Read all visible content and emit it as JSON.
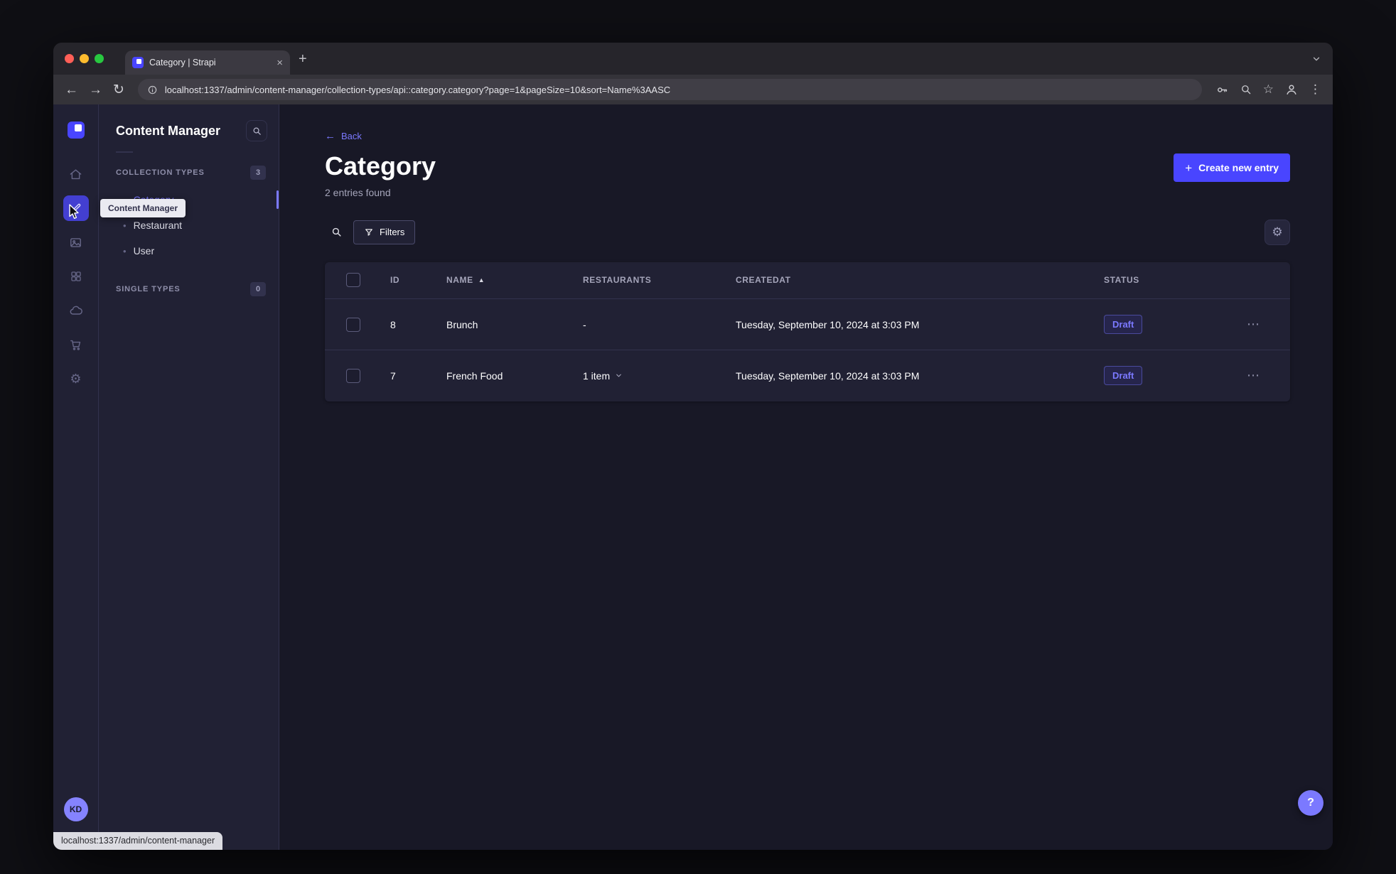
{
  "browser": {
    "tab_title": "Category | Strapi",
    "url": "localhost:1337/admin/content-manager/collection-types/api::category.category?page=1&pageSize=10&sort=Name%3AASC",
    "status_bubble": "localhost:1337/admin/content-manager"
  },
  "icons": {
    "back_arrow": "←",
    "forward_arrow": "→",
    "reload": "↻",
    "star": "☆",
    "menu_dots": "⋮",
    "close": "×",
    "new_tab": "+",
    "plus": "+",
    "bullet": "•",
    "row_actions": "⋯",
    "sort_asc": "▲",
    "gear": "⚙",
    "help": "?"
  },
  "rail": {
    "tooltip": "Content Manager",
    "avatar_initials": "KD"
  },
  "subnav": {
    "title": "Content Manager",
    "collection_types": {
      "label": "COLLECTION TYPES",
      "badge": "3",
      "items": [
        {
          "label": "Category",
          "active": true
        },
        {
          "label": "Restaurant",
          "active": false
        },
        {
          "label": "User",
          "active": false
        }
      ]
    },
    "single_types": {
      "label": "SINGLE TYPES",
      "badge": "0"
    }
  },
  "main": {
    "back_label": "Back",
    "title": "Category",
    "subtitle": "2 entries found",
    "create_button_label": "Create new entry",
    "filters_label": "Filters",
    "sort": {
      "column": "NAME",
      "direction": "asc"
    },
    "table": {
      "columns": [
        "ID",
        "NAME",
        "RESTAURANTS",
        "CREATEDAT",
        "STATUS"
      ],
      "rows": [
        {
          "id": "8",
          "name": "Brunch",
          "restaurants": "-",
          "createdat": "Tuesday, September 10, 2024 at 3:03 PM",
          "status": "Draft"
        },
        {
          "id": "7",
          "name": "French Food",
          "restaurants": "1 item",
          "createdat": "Tuesday, September 10, 2024 at 3:03 PM",
          "status": "Draft"
        }
      ]
    }
  },
  "colors": {
    "primary": "#4945ff",
    "primary_light": "#7b79ff",
    "app_background": "#181826",
    "card_background": "#212134",
    "border": "#32324d",
    "text_muted": "#a5a5ba",
    "draft_text": "#7b79ff"
  }
}
